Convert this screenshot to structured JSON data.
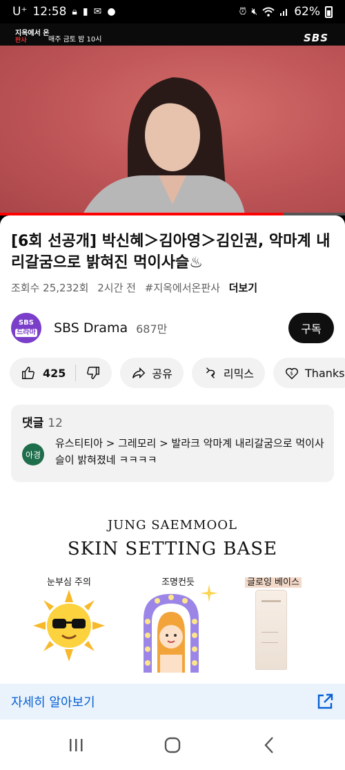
{
  "status_bar": {
    "carrier": "U⁺",
    "time": "12:58",
    "battery": "62%",
    "icons": [
      "lock-icon",
      "notification-icon",
      "mail-icon",
      "dot-icon",
      "alarm-icon",
      "mute-icon",
      "wifi-icon",
      "signal-icon",
      "battery-icon"
    ]
  },
  "video": {
    "show_logo": "지옥에서 온",
    "show_logo_sub": "판사",
    "airtime": "매주 금토 밤 10시",
    "network": "SBS",
    "progress": 0.82,
    "colors": {
      "progress": "#ff0000"
    }
  },
  "details": {
    "title": "[6회 선공개] 박신혜＞김아영＞김인권, 악마계 내리갈굼으로 밝혀진 먹이사슬♨",
    "views": "조회수 25,232회",
    "age": "2시간 전",
    "hashtag": "#지옥에서온판사",
    "more": "더보기"
  },
  "channel": {
    "avatar_line1": "SBS",
    "avatar_line2": "드라마",
    "name": "SBS Drama",
    "subscribers": "687만",
    "subscribe_label": "구독"
  },
  "actions": {
    "likes": "425",
    "share": "공유",
    "remix": "리믹스",
    "thanks": "Thanks"
  },
  "comments": {
    "label": "댓글",
    "count": "12",
    "top_avatar": "아경",
    "top_text": "유스티티아 > 그레모리 > 발라크 악마계 내리갈굼으로 먹이사슬이 밝혀졌네 ㅋㅋㅋㅋ"
  },
  "ad": {
    "brand": "JUNG SAEMMOOL",
    "headline": "SKIN SETTING BASE",
    "captions": [
      "눈부심 주의",
      "조명컨듯",
      "글로잉 베이스"
    ],
    "cta": "자세히 알아보기"
  },
  "nav": [
    "recents-icon",
    "home-icon",
    "back-icon"
  ]
}
